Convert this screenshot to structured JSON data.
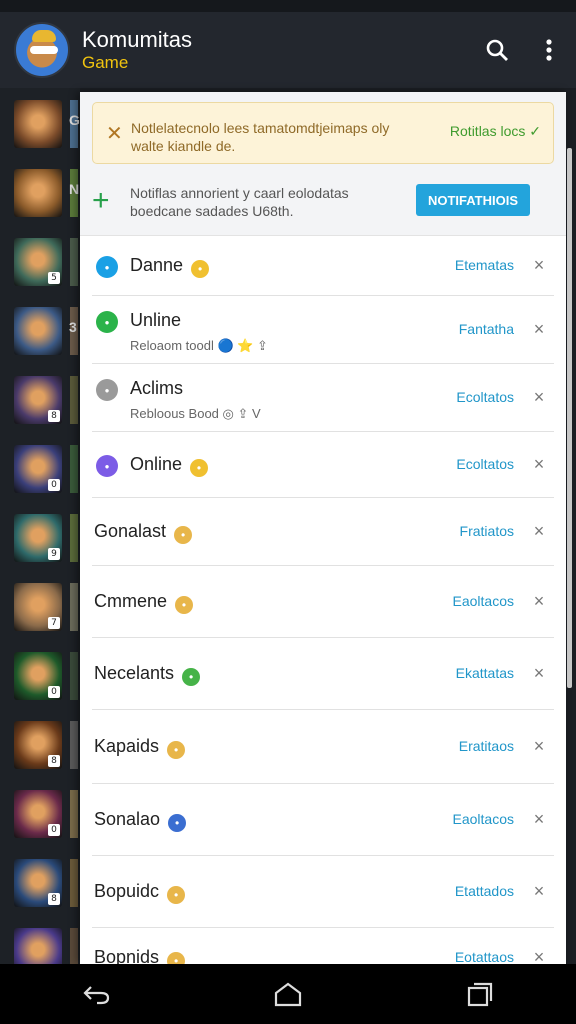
{
  "app": {
    "title": "Komumitas",
    "subtitle": "Game"
  },
  "warning": {
    "text": "Notlelatecnolo lees tamatomdtjeimaps oly walte kiandle de.",
    "link": "Rotitlas locs ✓"
  },
  "add": {
    "text": "Notiflas annorient y caarl eolodatas boedcane sadades U68th.",
    "button": "NOTIFATHIOIS"
  },
  "rows": [
    {
      "name": "Danne",
      "icon_color": "#1aa0e5",
      "emoji_color": "#f0c030",
      "sub": "",
      "action": "Etematas",
      "close": "×"
    },
    {
      "name": "Unline",
      "icon_color": "#2bb34a",
      "emoji_color": "",
      "sub": "Reloaom  toodl  🔵 ⭐ ⇪",
      "action": "Fantatha",
      "close": "×"
    },
    {
      "name": "Aclims",
      "icon_color": "#9a9a9a",
      "emoji_color": "",
      "sub": "Rebloous  Bood  ◎ ⇪ V",
      "action": "Ecoltatos",
      "close": "×"
    },
    {
      "name": "Online",
      "icon_color": "#7c5ce6",
      "emoji_color": "#f0c030",
      "sub": "",
      "action": "Ecoltatos",
      "close": "×"
    },
    {
      "name": "Gonalast",
      "icon_color": "",
      "emoji_color": "#e8b64a",
      "sub": "",
      "action": "Fratiatos",
      "close": "×"
    },
    {
      "name": "Cmmene",
      "icon_color": "",
      "emoji_color": "#e8b64a",
      "sub": "",
      "action": "Eaoltacos",
      "close": "×"
    },
    {
      "name": "Necelants",
      "icon_color": "",
      "emoji_color": "#46b348",
      "sub": "",
      "action": "Ekattatas",
      "close": "×"
    },
    {
      "name": "Kapaids",
      "icon_color": "",
      "emoji_color": "#e8b64a",
      "sub": "",
      "action": "Eratitaos",
      "close": "×"
    },
    {
      "name": "Sonalao",
      "icon_color": "",
      "emoji_color": "#3b6ed1",
      "sub": "",
      "action": "Eaoltacos",
      "close": "×"
    },
    {
      "name": "Bopuidc",
      "icon_color": "",
      "emoji_color": "#e8b64a",
      "sub": "",
      "action": "Etattados",
      "close": "×"
    },
    {
      "name": "Bopnids",
      "icon_color": "",
      "emoji_color": "#e8b64a",
      "sub": "",
      "action": "Eotattaos",
      "close": "×"
    }
  ],
  "left_games": [
    {
      "color": "#7b4b2a",
      "badge": "",
      "side": "#4c6e8e",
      "letter": "G"
    },
    {
      "color": "#8a5a2a",
      "badge": "",
      "side": "#5a7a3a",
      "letter": "N"
    },
    {
      "color": "#3f6a5a",
      "badge": "5",
      "side": "#4a5a4a",
      "letter": ""
    },
    {
      "color": "#3c5a86",
      "badge": "",
      "side": "#6a5a4a",
      "letter": "3"
    },
    {
      "color": "#4a3a6a",
      "badge": "8",
      "side": "#5a5a3a",
      "letter": ""
    },
    {
      "color": "#3a3f7a",
      "badge": "0",
      "side": "#3a5a3a",
      "letter": ""
    },
    {
      "color": "#2e6a6a",
      "badge": "9",
      "side": "#5a6a3a",
      "letter": ""
    },
    {
      "color": "#8a6a4a",
      "badge": "7",
      "side": "#6a6a5a",
      "letter": ""
    },
    {
      "color": "#1e5a2a",
      "badge": "0",
      "side": "#3a4a3a",
      "letter": ""
    },
    {
      "color": "#6a3a1a",
      "badge": "8",
      "side": "#5a5a5a",
      "letter": ""
    },
    {
      "color": "#6a2a4a",
      "badge": "0",
      "side": "#7a6a4a",
      "letter": ""
    },
    {
      "color": "#2a4a7a",
      "badge": "8",
      "side": "#6a5a3a",
      "letter": ""
    },
    {
      "color": "#4a3a8a",
      "badge": "",
      "side": "#5a4a3a",
      "letter": ""
    }
  ]
}
